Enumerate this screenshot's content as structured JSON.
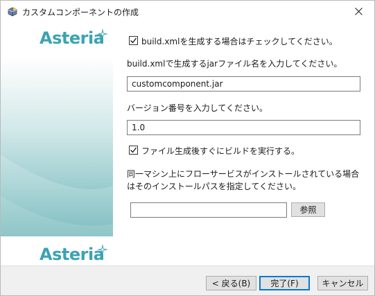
{
  "window": {
    "title": "カスタムコンポーネントの作成"
  },
  "brand": {
    "logo_text": "Asteria",
    "accent": "#3aa3b3"
  },
  "form": {
    "build_xml_checkbox": {
      "label": "build.xmlを生成する場合はチェックしてください。",
      "checked": true
    },
    "jar_name_prompt": "build.xmlで生成するjarファイル名を入力してください。",
    "jar_name_value": "customcomponent.jar",
    "version_prompt": "バージョン番号を入力してください。",
    "version_value": "1.0",
    "build_after_checkbox": {
      "label": "ファイル生成後すぐにビルドを実行する。",
      "checked": true
    },
    "install_path_prompt_line1": "同一マシン上にフローサービスがインストールされている場合",
    "install_path_prompt_line2": "はそのインストールパスを指定してください。",
    "install_path_value": "",
    "browse_button": "参照"
  },
  "footer": {
    "back_button": "< 戻る(B)",
    "finish_button": "完了(F)",
    "cancel_button": "キャンセル"
  }
}
